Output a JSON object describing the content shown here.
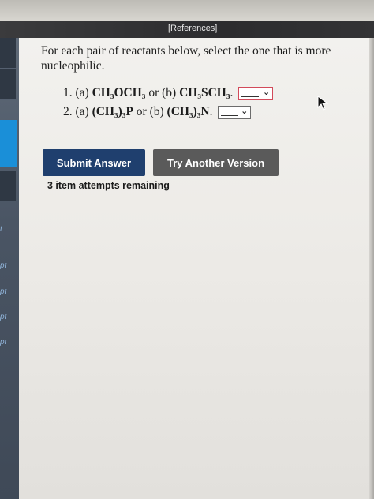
{
  "header": {
    "references_label": "[References]"
  },
  "sidebar": {
    "labels": [
      "t",
      "pt",
      "pt",
      "pt",
      "pt"
    ]
  },
  "question": {
    "prompt": "For each pair of reactants below, select the one that is more nucleophilic.",
    "items": [
      {
        "number": "1.",
        "a_label": "(a)",
        "a_formula": "CH₃OCH₃",
        "or_b": "or (b)",
        "b_formula": "CH₃SCH₃",
        "period": ".",
        "select_value": ""
      },
      {
        "number": "2.",
        "a_label": "(a)",
        "a_formula": "(CH₃)₃P",
        "or_b": "or (b)",
        "b_formula": "(CH₃)₃N",
        "period": ".",
        "select_value": ""
      }
    ]
  },
  "actions": {
    "submit_label": "Submit Answer",
    "try_label": "Try Another Version",
    "attempts_text": "3 item attempts remaining"
  },
  "icons": {
    "dropdown": "chevron-down-icon",
    "cursor": "mouse-pointer-icon"
  }
}
